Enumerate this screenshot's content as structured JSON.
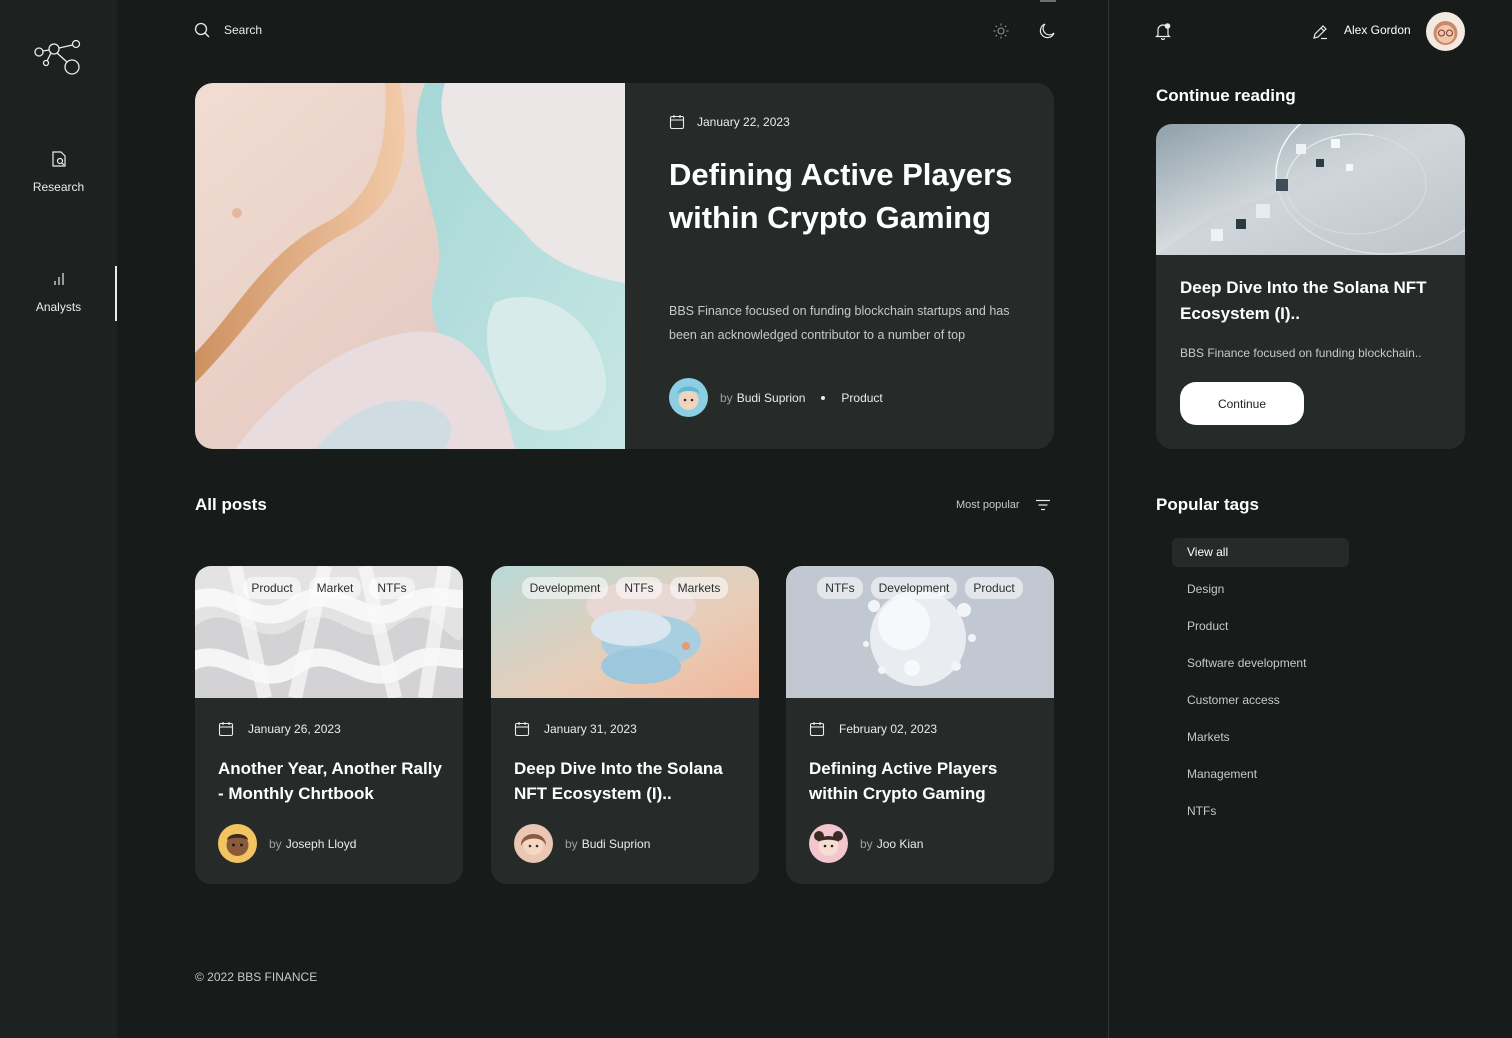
{
  "sidebar": {
    "items": [
      {
        "label": "Research",
        "icon": "research-icon"
      },
      {
        "label": "Analysts",
        "icon": "bar-chart-icon"
      }
    ],
    "active": "Analysts"
  },
  "header": {
    "search_label": "Search",
    "user_name": "Alex Gordon"
  },
  "hero": {
    "date": "January 22, 2023",
    "title": "Defining Active Players within Crypto Gaming",
    "description": "BBS Finance focused on funding blockchain startups and has been an acknowledged contributor to a number of top",
    "by": "by",
    "author": "Budi Suprion",
    "category": "Product"
  },
  "posts": {
    "title": "All posts",
    "sort_label": "Most popular",
    "items": [
      {
        "tags": [
          "Product",
          "Market",
          "NTFs"
        ],
        "date": "January 26, 2023",
        "title": "Another Year, Another Rally - Monthly Chrtbook",
        "by": "by",
        "author": "Joseph Lloyd"
      },
      {
        "tags": [
          "Development",
          "NTFs",
          "Markets"
        ],
        "date": "January 31, 2023",
        "title": "Deep Dive Into the Solana NFT Ecosystem (I)..",
        "by": "by",
        "author": "Budi Suprion"
      },
      {
        "tags": [
          "NTFs",
          "Development",
          "Product"
        ],
        "date": "February 02, 2023",
        "title": "Defining Active Players within Crypto Gaming",
        "by": "by",
        "author": "Joo Kian"
      }
    ]
  },
  "footer": {
    "copyright": "© 2022 BBS FINANCE"
  },
  "continue_reading": {
    "title": "Continue reading",
    "card_title": "Deep Dive Into the Solana NFT Ecosystem (I)..",
    "card_desc": "BBS Finance focused on funding blockchain..",
    "button": "Continue"
  },
  "popular_tags": {
    "title": "Popular tags",
    "items": [
      "View all",
      "Design",
      "Product",
      "Software development",
      "Customer access",
      "Markets",
      "Management",
      "NTFs"
    ]
  },
  "colors": {
    "background": "#171b1a",
    "card": "#262b2a",
    "sidebar": "#1d2221",
    "accent": "#ffffff"
  }
}
